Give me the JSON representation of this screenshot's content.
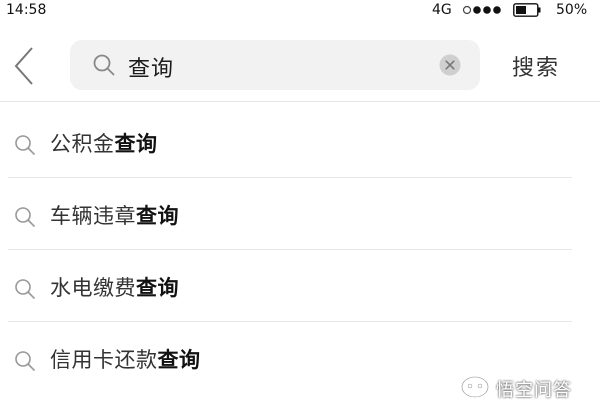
{
  "status_bar": {
    "time": "14:58",
    "network": "4G",
    "battery_percent": "50%",
    "battery_level": 0.5
  },
  "header": {
    "back_icon": "chevron-left-icon",
    "search": {
      "value": "查询",
      "icon": "search-icon",
      "clear_icon": "clear-icon"
    },
    "search_button_label": "搜索"
  },
  "suggestions": [
    {
      "prefix": "公积金",
      "highlight": "查询"
    },
    {
      "prefix": "车辆违章",
      "highlight": "查询"
    },
    {
      "prefix": "水电缴费",
      "highlight": "查询"
    },
    {
      "prefix": "信用卡还款",
      "highlight": "查询"
    }
  ],
  "watermark": {
    "text": "悟空问答"
  },
  "colors": {
    "search_box_bg": "#f2f2f2",
    "divider": "#e8e8e8",
    "text_primary": "#111111"
  }
}
